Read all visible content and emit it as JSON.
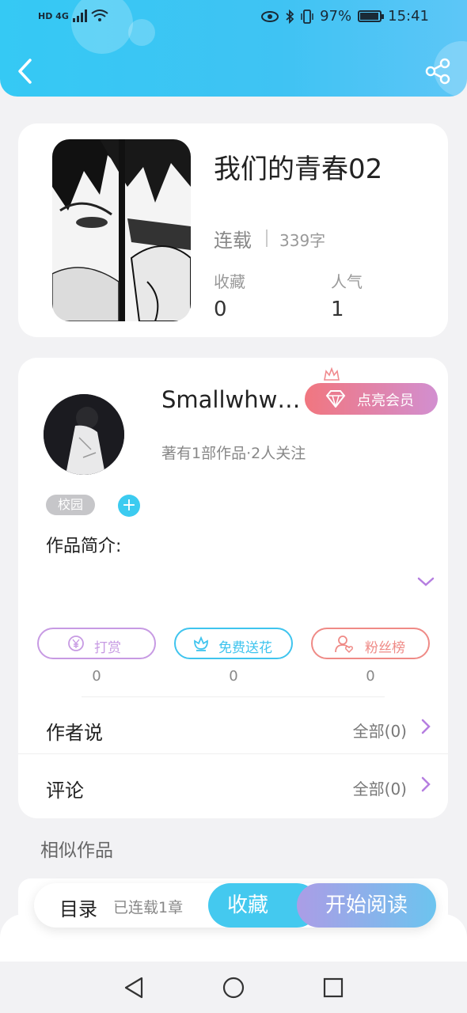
{
  "status_bar": {
    "network": "HD 4G",
    "battery": "97%",
    "time": "15:41"
  },
  "book": {
    "title": "我们的青春02",
    "status": "连载",
    "word_count": "339字",
    "favorites_label": "收藏",
    "favorites_value": "0",
    "popularity_label": "人气",
    "popularity_value": "1"
  },
  "author": {
    "name": "Smallwhwi...",
    "vip_button": "点亮会员",
    "meta": "著有1部作品·2人关注",
    "tag": "校园",
    "tag_add": "+",
    "intro_label": "作品简介:"
  },
  "actions": [
    {
      "label": "打赏",
      "count": "0",
      "color": "#c79ae3",
      "icon": "coin-icon"
    },
    {
      "label": "免费送花",
      "count": "0",
      "color": "#3fc4ee",
      "icon": "flower-icon"
    },
    {
      "label": "粉丝榜",
      "count": "0",
      "color": "#ef8a86",
      "icon": "fan-icon"
    }
  ],
  "sections": {
    "author_says": {
      "title": "作者说",
      "link": "全部(0)"
    },
    "comments": {
      "title": "评论",
      "link": "全部(0)"
    },
    "similar_title": "相似作品"
  },
  "bottom_bar": {
    "toc_label": "目录",
    "toc_count": "已连载1章",
    "favorite_button": "收藏",
    "read_button": "开始阅读"
  },
  "colors": {
    "header": "#3fc3f3",
    "accent_purple": "#b57ee0",
    "vip_gradient_start": "#f1767f"
  }
}
